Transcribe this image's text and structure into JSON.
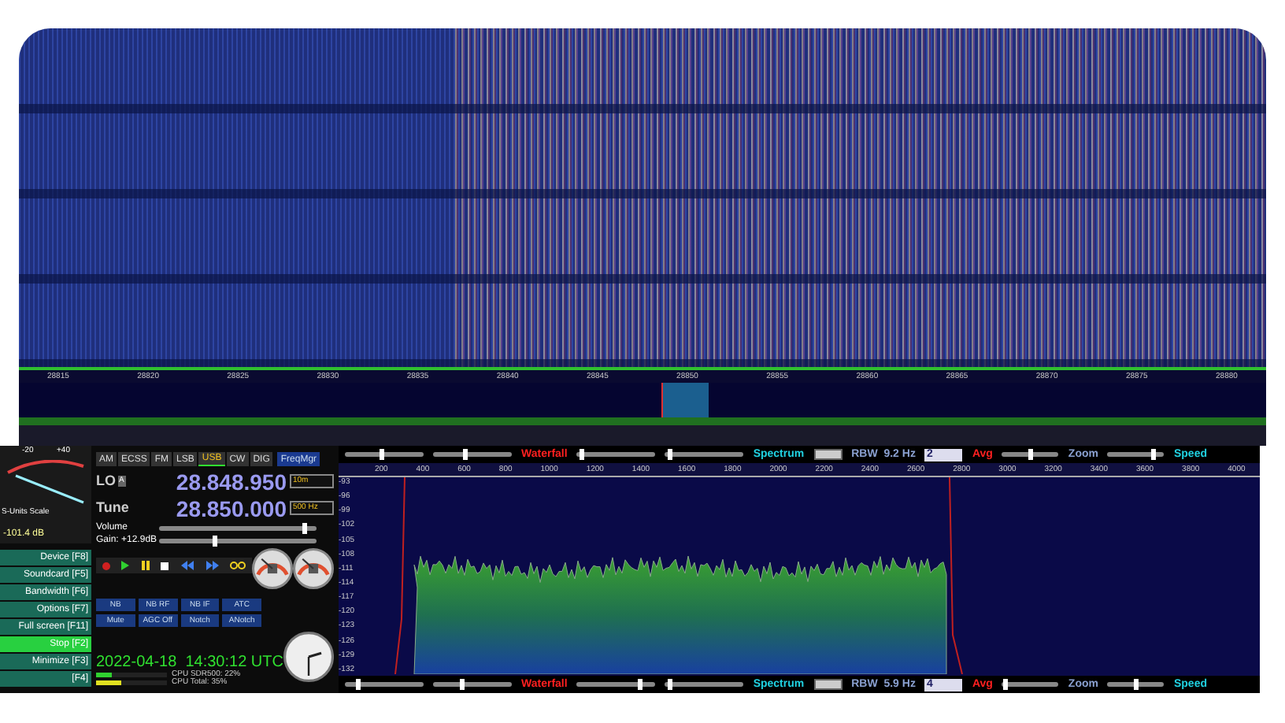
{
  "waterfall": {
    "freq_labels": [
      "28815",
      "28820",
      "28825",
      "28830",
      "28835",
      "28840",
      "28845",
      "28850",
      "28855",
      "28860",
      "28865",
      "28870",
      "28875",
      "28880"
    ]
  },
  "controls": {
    "modes": [
      {
        "label": "AM",
        "selected": false
      },
      {
        "label": "ECSS",
        "selected": false
      },
      {
        "label": "FM",
        "selected": false
      },
      {
        "label": "LSB",
        "selected": false
      },
      {
        "label": "USB",
        "selected": true
      },
      {
        "label": "CW",
        "selected": false
      },
      {
        "label": "DIG",
        "selected": false
      }
    ],
    "freq_manager": "FreqMgr",
    "lo": {
      "label": "LO",
      "badge": "A",
      "value": "28.848.950",
      "option": "10m"
    },
    "tune": {
      "label": "Tune",
      "value": "28.850.000",
      "option": "500 Hz"
    },
    "volume": {
      "label": "Volume",
      "level": 0.92
    },
    "gain": {
      "label": "Gain: +12.9dB",
      "level": 0.35
    },
    "smeter": {
      "scale_low": "-20",
      "scale_high": "+40",
      "caption": "S-Units Scale",
      "reading": "-101.4 dB"
    },
    "side_buttons": [
      {
        "label": "Device [F8]",
        "active": false
      },
      {
        "label": "Soundcard [F5]",
        "active": false
      },
      {
        "label": "Bandwidth [F6]",
        "active": false
      },
      {
        "label": "Options [F7]",
        "active": false
      },
      {
        "label": "Full screen [F11]",
        "active": false
      },
      {
        "label": "Stop [F2]",
        "active": true
      },
      {
        "label": "Minimize [F3]",
        "active": false
      },
      {
        "label": "[F4]",
        "active": false
      }
    ],
    "dsp_buttons": [
      "NB",
      "NB RF",
      "NB IF",
      "ATC",
      "Mute",
      "AGC Off",
      "Notch",
      "ANotch"
    ],
    "datetime": "2022-04-18  14:30:12 UTC",
    "cpu": [
      {
        "label": "CPU SDR500: 22%",
        "level": 0.22
      },
      {
        "label": "CPU Total: 35%",
        "level": 0.35
      }
    ]
  },
  "spectrum": {
    "top_bar": {
      "sliders": [
        {
          "level": 0.45
        },
        {
          "level": 0.4
        },
        {
          "level": 0.05
        },
        {
          "level": 0.05
        }
      ],
      "waterfall": "Waterfall",
      "spectrum": "Spectrum",
      "rbw": "RBW  9.2 Hz",
      "avg_value": "2",
      "avg": "Avg",
      "zoom_sliders": [
        {
          "level": 0.5
        },
        {
          "level": 0.8
        }
      ],
      "zoom": "Zoom",
      "speed": "Speed"
    },
    "x_labels": [
      "200",
      "400",
      "600",
      "800",
      "1000",
      "1200",
      "1400",
      "1600",
      "1800",
      "2000",
      "2200",
      "2400",
      "2600",
      "2800",
      "3000",
      "3200",
      "3400",
      "3600",
      "3800",
      "4000"
    ],
    "y_labels": [
      "-93",
      "-96",
      "-99",
      "-102",
      "-105",
      "-108",
      "-111",
      "-114",
      "-117",
      "-120",
      "-123",
      "-126",
      "-129",
      "-132"
    ],
    "bottom_bar": {
      "sliders": [
        {
          "level": 0.15
        },
        {
          "level": 0.35
        },
        {
          "level": 0.8
        },
        {
          "level": 0.05
        }
      ],
      "waterfall": "Waterfall",
      "spectrum": "Spectrum",
      "rbw": "RBW  5.9 Hz",
      "avg_value": "4",
      "avg": "Avg",
      "zoom_sliders": [
        {
          "level": 0.05
        },
        {
          "level": 0.5
        }
      ],
      "zoom": "Zoom",
      "speed": "Speed"
    }
  }
}
